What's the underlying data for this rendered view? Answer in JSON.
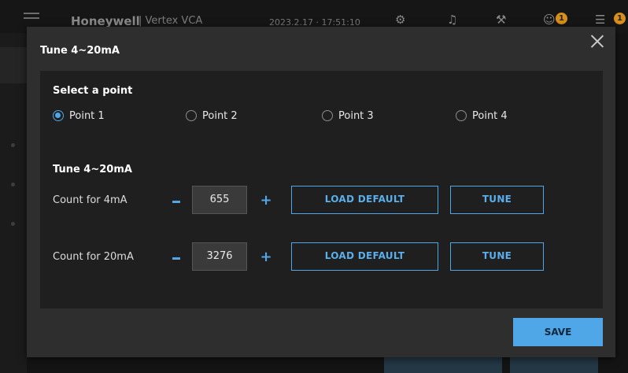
{
  "app_header": {
    "brand": "Honeywell",
    "product": "| Vertex VCA",
    "datetime": "2023.2.17 · 17:51:10",
    "alarm_count": "1",
    "notification_count": "1"
  },
  "modal": {
    "title": "Tune 4~20mA",
    "select_point": {
      "heading": "Select a point",
      "options": [
        "Point 1",
        "Point 2",
        "Point 3",
        "Point 4"
      ],
      "selected": "Point 1"
    },
    "tune": {
      "heading": "Tune 4~20mA",
      "rows": [
        {
          "label": "Count for 4mA",
          "value": "655",
          "load_default_label": "LOAD DEFAULT",
          "tune_label": "TUNE"
        },
        {
          "label": "Count for 20mA",
          "value": "3276",
          "load_default_label": "LOAD DEFAULT",
          "tune_label": "TUNE"
        }
      ],
      "minus_symbol": "−",
      "plus_symbol": "+"
    },
    "save_label": "SAVE"
  },
  "colors": {
    "accent": "#4fa7e8",
    "modal_bg": "#2e2e2e",
    "panel_bg": "#1f1f1f",
    "badge": "#d9901a"
  },
  "icons": [
    "hamburger-icon",
    "settings-network-icon",
    "bell-icon",
    "tools-icon",
    "user-icon",
    "list-icon",
    "close-icon"
  ]
}
